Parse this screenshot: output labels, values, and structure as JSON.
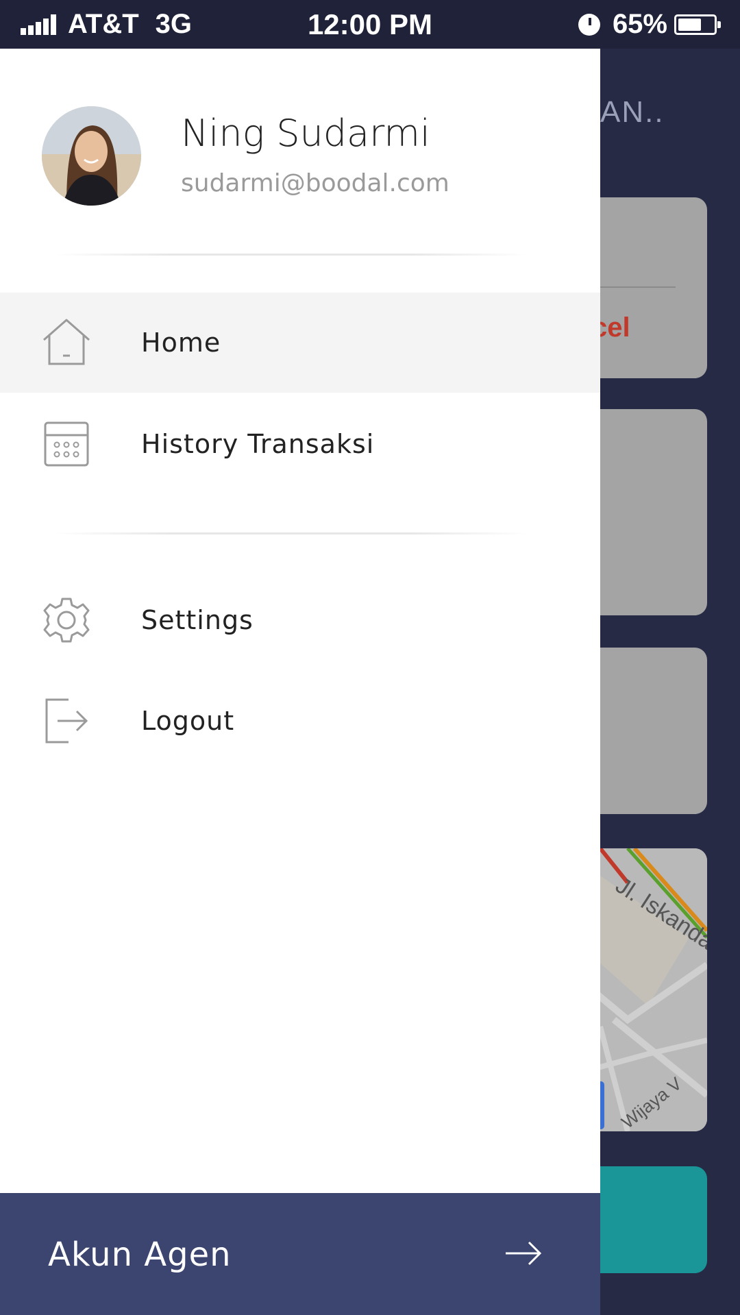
{
  "status_bar": {
    "carrier": "AT&T",
    "network": "3G",
    "time": "12:00 PM",
    "battery": "65%",
    "battery_level": 0.65
  },
  "background_app": {
    "title_fragment": "AN..",
    "cancel_fragment": "cel",
    "map_street_1": "Jl. Iskanda",
    "map_street_2": "Wijaya V"
  },
  "drawer": {
    "profile": {
      "name": "Ning Sudarmi",
      "email": "sudarmi@boodal.com"
    },
    "menu": [
      {
        "label": "Home",
        "icon": "home-icon",
        "active": true
      },
      {
        "label": "History Transaksi",
        "icon": "calculator-icon",
        "active": false
      }
    ],
    "secondary_menu": [
      {
        "label": "Settings",
        "icon": "gear-icon"
      },
      {
        "label": "Logout",
        "icon": "logout-icon"
      }
    ],
    "footer": {
      "label": "Akun Agen",
      "icon": "arrow-right-icon"
    }
  },
  "colors": {
    "status_bar_bg": "#1f2238",
    "background_app": "#262a45",
    "drawer_bg": "#ffffff",
    "active_item_bg": "#f4f4f4",
    "footer_bg": "#3c4570",
    "accent_teal": "#1a9598",
    "cancel_red": "#c0392b"
  }
}
